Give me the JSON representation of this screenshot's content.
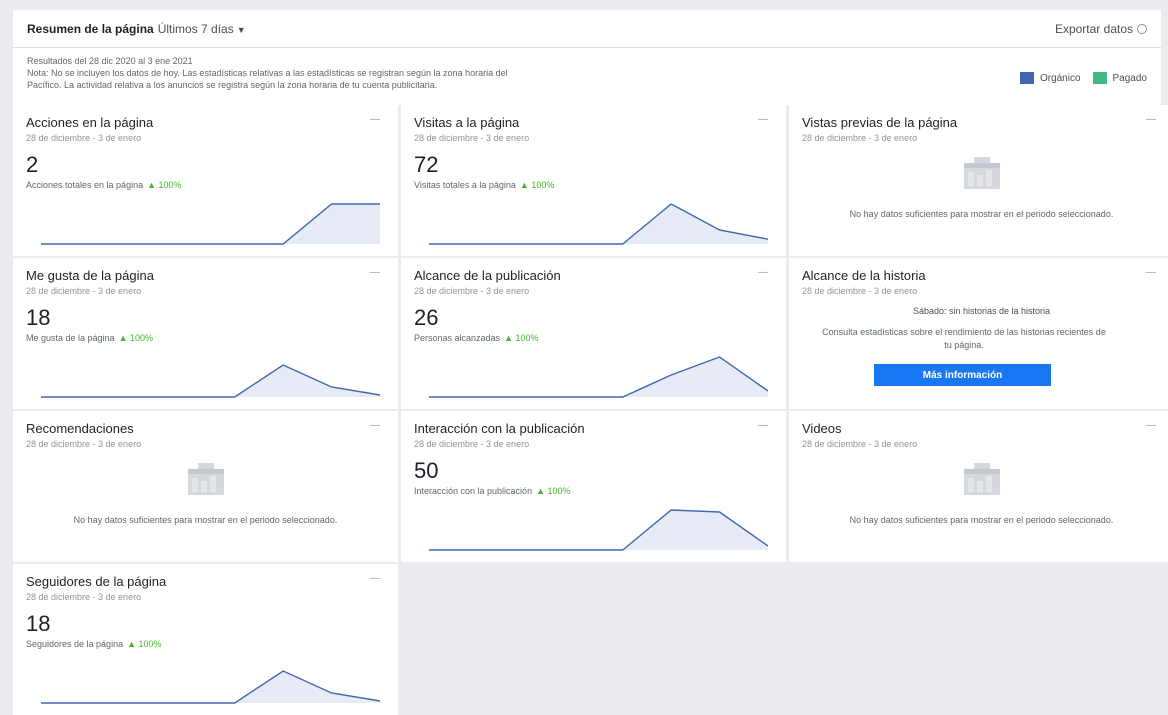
{
  "header": {
    "title": "Resumen de la página",
    "range": "Últimos 7 días",
    "export_label": "Exportar datos"
  },
  "notes": {
    "line1": "Resultados del 28 dic 2020 al 3 ene 2021",
    "line2": "Nota: No se incluyen los datos de hoy. Las estadísticas relativas a las estadísticas se registran según la zona horaria del",
    "line3": "Pacífico. La actividad relativa a los anuncios se registra según la zona horaria de tu cuenta publicitaria."
  },
  "legend": {
    "organic_label": "Orgánico",
    "paid_label": "Pagado",
    "organic_color": "#4267b2",
    "paid_color": "#42b883"
  },
  "cards": [
    {
      "title": "Acciones en la página",
      "date": "28 de diciembre - 3 de enero",
      "value": "2",
      "desc": "Acciones totales en la página",
      "pct": "▲ 100%",
      "spark": [
        0,
        0,
        0,
        0,
        0,
        0,
        1,
        1
      ]
    },
    {
      "title": "Visitas a la página",
      "date": "28 de diciembre - 3 de enero",
      "value": "72",
      "desc": "Visitas totales a la página",
      "pct": "▲ 100%",
      "spark": [
        0,
        0,
        0,
        0,
        0,
        1,
        0.35,
        0.12
      ]
    },
    {
      "title": "Vistas previas de la página",
      "date": "28 de diciembre - 3 de enero",
      "nodata": "No hay datos suficientes para mostrar en el periodo seleccionado."
    },
    {
      "title": "Me gusta de la página",
      "date": "28 de diciembre - 3 de enero",
      "value": "18",
      "desc": "Me gusta de la página",
      "pct": "▲ 100%",
      "spark": [
        0,
        0,
        0,
        0,
        0,
        0.8,
        0.25,
        0.05
      ]
    },
    {
      "title": "Alcance de la publicación",
      "date": "28 de diciembre - 3 de enero",
      "value": "26",
      "desc": "Personas alcanzadas",
      "pct": "▲ 100%",
      "spark": [
        0,
        0,
        0,
        0,
        0,
        0.55,
        1,
        0.15
      ]
    },
    {
      "title": "Alcance de la historia",
      "date": "28 de diciembre - 3 de enero",
      "story_sub": "Sábado: sin historias de la historia",
      "story_text": "Consulta estadísticas sobre el rendimiento de las historias recientes de tu página.",
      "button": "Más información"
    },
    {
      "title": "Recomendaciones",
      "date": "28 de diciembre - 3 de enero",
      "nodata": "No hay datos suficientes para mostrar en el periodo seleccionado."
    },
    {
      "title": "Interacción con la publicación",
      "date": "28 de diciembre - 3 de enero",
      "value": "50",
      "desc": "Interacción con la publicación",
      "pct": "▲ 100%",
      "spark": [
        0,
        0,
        0,
        0,
        0,
        1,
        0.95,
        0.1
      ]
    },
    {
      "title": "Videos",
      "date": "28 de diciembre - 3 de enero",
      "nodata": "No hay datos suficientes para mostrar en el periodo seleccionado."
    },
    {
      "title": "Seguidores de la página",
      "date": "28 de diciembre - 3 de enero",
      "value": "18",
      "desc": "Seguidores de la página",
      "pct": "▲ 100%",
      "spark": [
        0,
        0,
        0,
        0,
        0,
        0.8,
        0.25,
        0.05
      ]
    }
  ]
}
